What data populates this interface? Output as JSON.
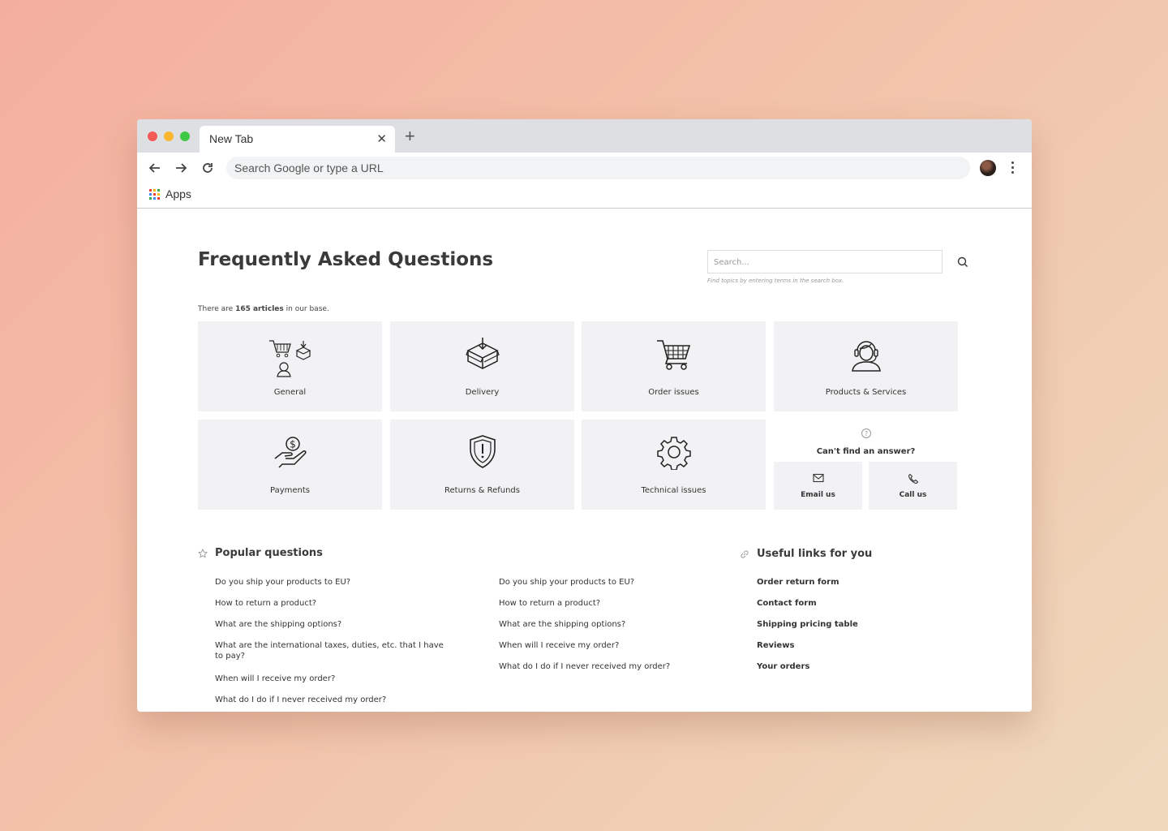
{
  "browser": {
    "tab_title": "New Tab",
    "omnibox_placeholder": "Search Google or type a URL",
    "bookmarks_apps": "Apps",
    "colors": {
      "red": "#f25b56",
      "yellow": "#f7b731",
      "green": "#3ec645"
    }
  },
  "faq": {
    "title": "Frequently Asked Questions",
    "search_placeholder": "Search...",
    "search_hint": "Find topics by entering terms in the search box.",
    "count_prefix": "There are ",
    "count_value": "165 articles",
    "count_suffix": " in our base.",
    "categories": [
      {
        "label": "General",
        "icon": "general-icon"
      },
      {
        "label": "Delivery",
        "icon": "box-icon"
      },
      {
        "label": "Order issues",
        "icon": "cart-icon"
      },
      {
        "label": "Products & Services",
        "icon": "support-agent-icon"
      },
      {
        "label": "Payments",
        "icon": "hand-coin-icon"
      },
      {
        "label": "Returns & Refunds",
        "icon": "shield-icon"
      },
      {
        "label": "Technical issues",
        "icon": "gear-icon"
      }
    ],
    "contact": {
      "question": "Can't find an answer?",
      "email": "Email us",
      "call": "Call us"
    }
  },
  "popular": {
    "heading": "Popular questions",
    "col1": [
      "Do you ship your products to EU?",
      "How to return a product?",
      "What are the shipping options?",
      "What are the international taxes, duties, etc. that I have to pay?",
      "When will I receive my order?",
      "What do I do if I never received my order?"
    ],
    "col2": [
      "Do you ship your products to EU?",
      "How to return a product?",
      "What are the shipping options?",
      "When will I receive my order?",
      "What do I do if I never received my order?"
    ]
  },
  "useful": {
    "heading": "Useful links for you",
    "links": [
      "Order return form",
      "Contact form",
      "Shipping pricing table",
      "Reviews",
      "Your orders"
    ]
  }
}
